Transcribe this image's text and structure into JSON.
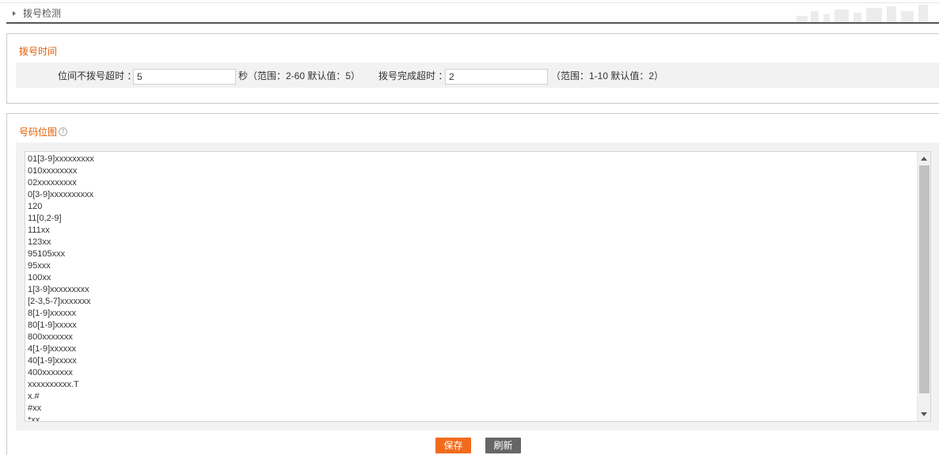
{
  "header": {
    "title": "拨号检测"
  },
  "dial_time": {
    "title": "拨号时间",
    "interdigit_label": "位间不拨号超时 ：",
    "interdigit_value": "5",
    "interdigit_unit_hint": "秒（范围：2-60 默认值：5）",
    "complete_label": "拨号完成超时 ：",
    "complete_value": "2",
    "complete_hint": "（范围：1-10 默认值：2）"
  },
  "digit_map": {
    "title": "号码位图",
    "help_icon": "question-circle-icon",
    "lines": [
      "01[3-9]xxxxxxxxx",
      "010xxxxxxxx",
      "02xxxxxxxxx",
      "0[3-9]xxxxxxxxxx",
      "120",
      "11[0,2-9]",
      "111xx",
      "123xx",
      "95105xxx",
      "95xxx",
      "100xx",
      "1[3-9]xxxxxxxxx",
      "[2-3,5-7]xxxxxxx",
      "8[1-9]xxxxxx",
      "80[1-9]xxxxx",
      "800xxxxxxx",
      "4[1-9]xxxxxx",
      "40[1-9]xxxxx",
      "400xxxxxxx",
      "xxxxxxxxxx.T",
      "x.#",
      "#xx",
      "*xx"
    ]
  },
  "buttons": {
    "save": "保存",
    "refresh": "刷新"
  },
  "colors": {
    "accent": "#f26b1d",
    "section_title": "#e65c00",
    "refresh_button": "#666666"
  }
}
